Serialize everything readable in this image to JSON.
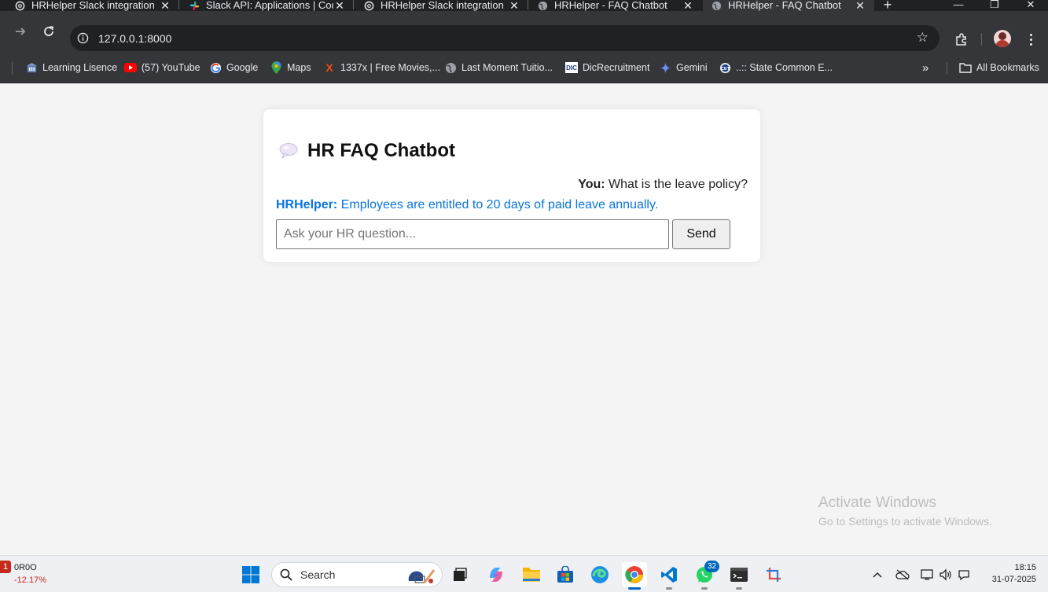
{
  "browser": {
    "tabs": [
      {
        "title": "HRHelper Slack integration",
        "icon": "openai-icon"
      },
      {
        "title": "Slack API: Applications | Cod",
        "icon": "slack-icon"
      },
      {
        "title": "HRHelper Slack integration",
        "icon": "openai-icon"
      },
      {
        "title": "HRHelper - FAQ Chatbot",
        "icon": "globe-icon"
      },
      {
        "title": "HRHelper - FAQ Chatbot",
        "icon": "globe-icon",
        "active": true
      }
    ],
    "url": "127.0.0.1:8000",
    "bookmarks": [
      {
        "label": "Learning Lisence",
        "icon": "building-icon"
      },
      {
        "label": "(57) YouTube",
        "icon": "youtube-icon"
      },
      {
        "label": "Google",
        "icon": "google-icon"
      },
      {
        "label": "Maps",
        "icon": "maps-icon"
      },
      {
        "label": "1337x | Free Movies,...",
        "icon": "x-icon"
      },
      {
        "label": "Last Moment Tuitio...",
        "icon": "globe-icon"
      },
      {
        "label": "DicRecruitment",
        "icon": "dic-icon"
      },
      {
        "label": "Gemini",
        "icon": "gemini-icon"
      },
      {
        "label": "..:: State Common E...",
        "icon": "cet-icon"
      }
    ],
    "all_bookmarks_label": "All Bookmarks"
  },
  "chat": {
    "title": "HR FAQ Chatbot",
    "user_label": "You:",
    "user_message": "What is the leave policy?",
    "bot_label": "HRHelper:",
    "bot_message": "Employees are entitled to 20 days of paid leave annually.",
    "input_placeholder": "Ask your HR question...",
    "input_value": "",
    "send_label": "Send",
    "bot_color": "#0a74da"
  },
  "watermark": {
    "line1": "Activate Windows",
    "line2": "Go to Settings to activate Windows."
  },
  "taskbar": {
    "stock_badge": "1",
    "stock_name": "0R0O",
    "stock_change": "-12.17%",
    "search_label": "Search",
    "whatsapp_badge": "32",
    "time": "18:15",
    "date": "31-07-2025"
  }
}
